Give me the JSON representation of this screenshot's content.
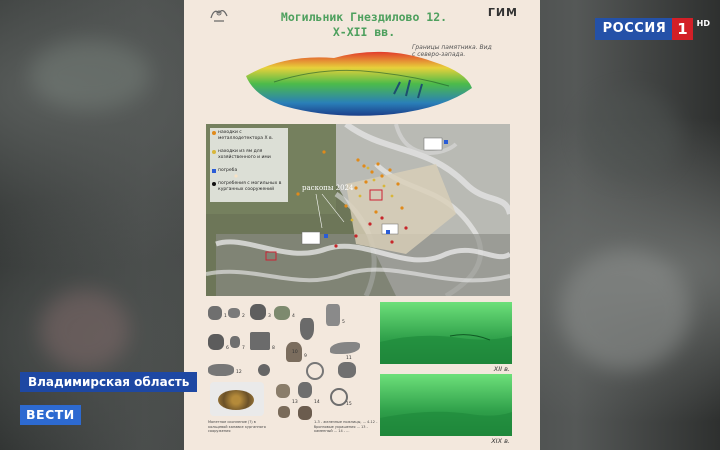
{
  "poster": {
    "museum_logo": "ГИМ",
    "title_line1": "Могильник Гнездилово 12.",
    "title_line2": "X-XII вв.",
    "boundary_note": "Границы памятника. Вид с северо-запада.",
    "map_legend": [
      {
        "text": "находки с металлодетектора X в.",
        "color": "#e08a1a"
      },
      {
        "text": "находки из ям для хозяйственного и ими",
        "color": "#d8b63a"
      },
      {
        "text": "погреба",
        "color": "#2a5cd6"
      },
      {
        "text": "погребения с могильных в курганных сооружений",
        "color": "#111111"
      }
    ],
    "excavation_label": "раскопы 2024",
    "find_numbers": [
      "1",
      "2",
      "3",
      "4",
      "5",
      "6",
      "7",
      "8",
      "9",
      "10",
      "11",
      "12",
      "13",
      "14",
      "15"
    ],
    "finds_caption": "Монетное скопление (?) в кольцевой канавке курганного сооружения",
    "finds_notes": "1-3 - железные ножницы, ... 4-12 - бронзовые украшения ... 13 - каменный ... 14 - ...",
    "photo_captions": [
      "XII в.",
      "XIX в."
    ]
  },
  "broadcast": {
    "channel_name": "РОССИЯ",
    "channel_number": "1",
    "hd_label": "HD",
    "region": "Владимирская область",
    "program": "ВЕСТИ"
  }
}
